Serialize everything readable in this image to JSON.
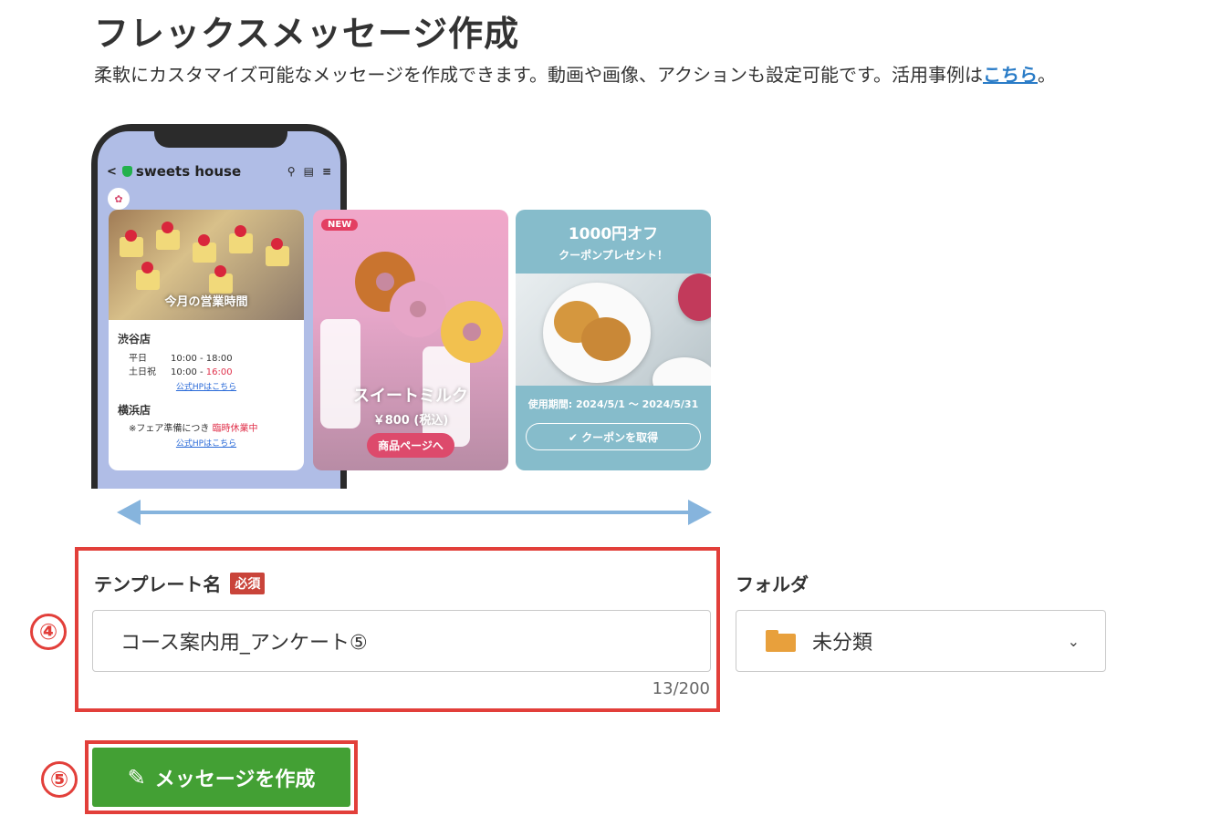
{
  "page": {
    "title": "フレックスメッセージ作成",
    "description": "柔軟にカスタマイズ可能なメッセージを作成できます。動画や画像、アクションも設定可能です。活用事例は",
    "link_text": "こちら",
    "description_end": "。"
  },
  "preview": {
    "account_name": "sweets house",
    "card1": {
      "image_caption": "今月の営業時間",
      "store1": "渋谷店",
      "weekday_label": "平日",
      "weekday_hours": "10:00 - 18:00",
      "holiday_label": "土日祝",
      "holiday_hours_start": "10:00 - ",
      "holiday_hours_end": "16:00",
      "link1": "公式HPはこちら",
      "store2": "横浜店",
      "notice_prefix": "※フェア準備につき ",
      "notice_highlight": "臨時休業中",
      "link2": "公式HPはこちら"
    },
    "card2": {
      "badge": "NEW",
      "product_name": "スイートミルク",
      "price": "￥800 (税込)",
      "button": "商品ページへ"
    },
    "card3": {
      "headline": "1000円オフ",
      "subline": "クーポンプレゼント！",
      "period": "使用期間: 2024/5/1 〜 2024/5/31",
      "button": "✔ クーポンを取得"
    }
  },
  "form": {
    "step_name": "④",
    "template_label": "テンプレート名",
    "required_badge": "必須",
    "template_value": "コース案内用_アンケート⑤",
    "char_count": "13/200",
    "folder_label": "フォルダ",
    "folder_value": "未分類",
    "step_button": "⑤",
    "create_button": "メッセージを作成"
  },
  "colors": {
    "accent_red": "#e23f3a",
    "button_green": "#43a034",
    "link_blue": "#2a7cc7",
    "folder_orange": "#e8a03c"
  }
}
